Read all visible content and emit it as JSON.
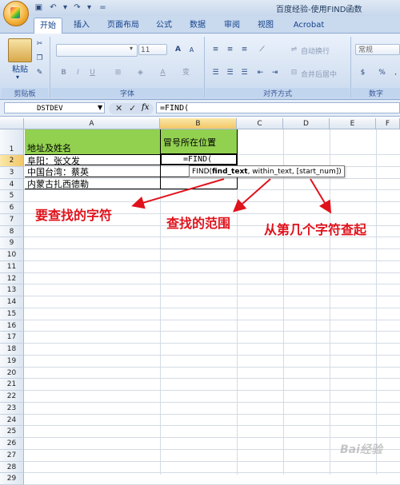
{
  "window": {
    "title": "百度经验-使用FIND函数"
  },
  "tabs": [
    "开始",
    "插入",
    "页面布局",
    "公式",
    "数据",
    "审阅",
    "视图",
    "Acrobat"
  ],
  "ribbon": {
    "paste_label": "粘贴",
    "clipboard_label": "剪贴板",
    "font_label": "字体",
    "font_size": "11",
    "alignment_label": "对齐方式",
    "wrap_text": "自动换行",
    "merge_center": "合并后居中",
    "number_format": "常规",
    "number_label": "数字",
    "bold": "B",
    "italic": "I",
    "underline": "U",
    "percent": "%",
    "font_grow": "A",
    "font_shrink": "A"
  },
  "formula_bar": {
    "name_box": "DSTDEV",
    "fx": "fx",
    "content": "=FIND("
  },
  "columns": [
    "A",
    "B",
    "C",
    "D",
    "E",
    "F"
  ],
  "rows": [
    "1",
    "2",
    "3",
    "4",
    "5",
    "6",
    "7",
    "8",
    "9",
    "10",
    "11",
    "12",
    "13",
    "14",
    "15",
    "16",
    "17",
    "18",
    "19",
    "20",
    "21",
    "22",
    "23",
    "24",
    "25",
    "26",
    "27",
    "28",
    "29"
  ],
  "cells": {
    "A1": "地址及姓名",
    "B1": "冒号所在位置",
    "A2": "阜阳：张文发",
    "B2": "=FIND(",
    "A3": "中国台湾：蔡英",
    "A4": "内蒙古扎西德勒"
  },
  "tooltip": {
    "fn": "FIND(",
    "arg1": "find_text",
    "rest": ", within_text, [start_num])"
  },
  "annotations": {
    "find_text": "要查找的字符",
    "within_text": "查找的范围",
    "start_num": "从第几个字符查起"
  },
  "watermark": "Bai经验",
  "colors": {
    "header_fill": "#92d050",
    "annotation_red": "#e0121b",
    "selected_header": "#f2c668"
  }
}
